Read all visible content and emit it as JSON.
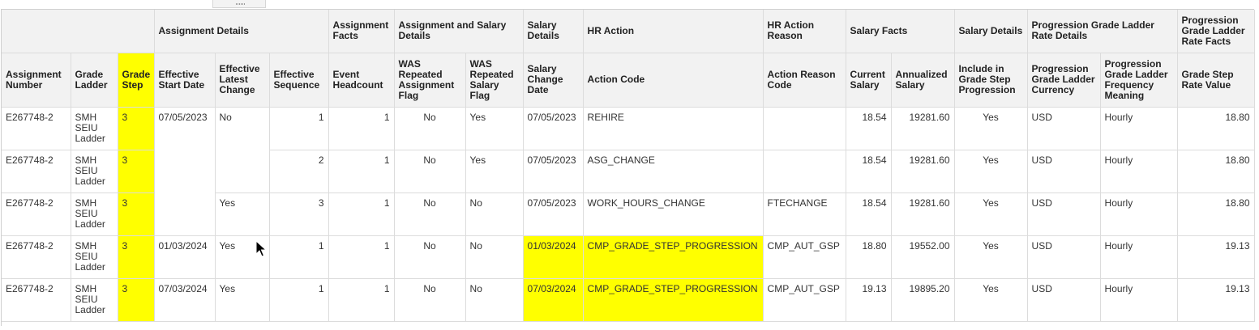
{
  "groups": [
    {
      "key": "blank",
      "label": ""
    },
    {
      "key": "assignment_details",
      "label": "Assignment Details"
    },
    {
      "key": "assignment_facts",
      "label": "Assignment Facts"
    },
    {
      "key": "assignment_salary_details",
      "label": "Assignment and Salary Details"
    },
    {
      "key": "salary_details",
      "label": "Salary Details"
    },
    {
      "key": "hr_action",
      "label": "HR Action"
    },
    {
      "key": "hr_action_reason",
      "label": "HR Action Reason"
    },
    {
      "key": "salary_facts",
      "label": "Salary Facts"
    },
    {
      "key": "salary_details2",
      "label": "Salary Details"
    },
    {
      "key": "progression_rate_details",
      "label": "Progression Grade Ladder Rate Details"
    },
    {
      "key": "progression_rate_facts",
      "label": "Progression Grade Ladder Rate Facts"
    }
  ],
  "columns": [
    {
      "key": "assignment_number",
      "label": "Assignment Number"
    },
    {
      "key": "grade_ladder",
      "label": "Grade Ladder"
    },
    {
      "key": "grade_step",
      "label": "Grade Step"
    },
    {
      "key": "effective_start_date",
      "label": "Effective Start Date"
    },
    {
      "key": "effective_latest_change",
      "label": "Effective Latest Change"
    },
    {
      "key": "effective_sequence",
      "label": "Effective Sequence"
    },
    {
      "key": "event_headcount",
      "label": "Event Headcount"
    },
    {
      "key": "was_repeated_assignment_flag",
      "label": "WAS Repeated Assignment Flag"
    },
    {
      "key": "was_repeated_salary_flag",
      "label": "WAS Repeated Salary Flag"
    },
    {
      "key": "salary_change_date",
      "label": "Salary Change Date"
    },
    {
      "key": "action_code",
      "label": "Action Code"
    },
    {
      "key": "action_reason_code",
      "label": "Action Reason Code"
    },
    {
      "key": "current_salary",
      "label": "Current Salary"
    },
    {
      "key": "annualized_salary",
      "label": "Annualized Salary"
    },
    {
      "key": "include_in_grade_step_progression",
      "label": "Include in Grade Step Progression"
    },
    {
      "key": "progression_grade_ladder_currency",
      "label": "Progression Grade Ladder Currency"
    },
    {
      "key": "progression_grade_ladder_frequency_meaning",
      "label": "Progression Grade Ladder Frequency Meaning"
    },
    {
      "key": "grade_step_rate_value",
      "label": "Grade Step Rate Value"
    }
  ],
  "rows": [
    {
      "assignment_number": "E267748-2",
      "grade_ladder": "SMH SEIU Ladder",
      "grade_step": "3",
      "effective_start_date": "07/05/2023",
      "effective_latest_change": "No",
      "effective_sequence": "1",
      "event_headcount": "1",
      "was_repeated_assignment_flag": "No",
      "was_repeated_salary_flag": "Yes",
      "salary_change_date": "07/05/2023",
      "action_code": "REHIRE",
      "action_reason_code": "",
      "current_salary": "18.54",
      "annualized_salary": "19281.60",
      "include_in_grade_step_progression": "Yes",
      "progression_grade_ladder_currency": "USD",
      "progression_grade_ladder_frequency_meaning": "Hourly",
      "grade_step_rate_value": "18.80"
    },
    {
      "assignment_number": "E267748-2",
      "grade_ladder": "SMH SEIU Ladder",
      "grade_step": "3",
      "effective_start_date": "",
      "effective_latest_change": "",
      "effective_sequence": "2",
      "event_headcount": "1",
      "was_repeated_assignment_flag": "No",
      "was_repeated_salary_flag": "Yes",
      "salary_change_date": "07/05/2023",
      "action_code": "ASG_CHANGE",
      "action_reason_code": "",
      "current_salary": "18.54",
      "annualized_salary": "19281.60",
      "include_in_grade_step_progression": "Yes",
      "progression_grade_ladder_currency": "USD",
      "progression_grade_ladder_frequency_meaning": "Hourly",
      "grade_step_rate_value": "18.80"
    },
    {
      "assignment_number": "E267748-2",
      "grade_ladder": "SMH SEIU Ladder",
      "grade_step": "3",
      "effective_start_date": "",
      "effective_latest_change": "Yes",
      "effective_sequence": "3",
      "event_headcount": "1",
      "was_repeated_assignment_flag": "No",
      "was_repeated_salary_flag": "No",
      "salary_change_date": "07/05/2023",
      "action_code": "WORK_HOURS_CHANGE",
      "action_reason_code": "FTECHANGE",
      "current_salary": "18.54",
      "annualized_salary": "19281.60",
      "include_in_grade_step_progression": "Yes",
      "progression_grade_ladder_currency": "USD",
      "progression_grade_ladder_frequency_meaning": "Hourly",
      "grade_step_rate_value": "18.80"
    },
    {
      "assignment_number": "E267748-2",
      "grade_ladder": "SMH SEIU Ladder",
      "grade_step": "3",
      "effective_start_date": "01/03/2024",
      "effective_latest_change": "Yes",
      "effective_sequence": "1",
      "event_headcount": "1",
      "was_repeated_assignment_flag": "No",
      "was_repeated_salary_flag": "No",
      "salary_change_date": "01/03/2024",
      "action_code": "CMP_GRADE_STEP_PROGRESSION",
      "action_reason_code": "CMP_AUT_GSP",
      "current_salary": "18.80",
      "annualized_salary": "19552.00",
      "include_in_grade_step_progression": "Yes",
      "progression_grade_ladder_currency": "USD",
      "progression_grade_ladder_frequency_meaning": "Hourly",
      "grade_step_rate_value": "19.13"
    },
    {
      "assignment_number": "E267748-2",
      "grade_ladder": "SMH SEIU Ladder",
      "grade_step": "3",
      "effective_start_date": "07/03/2024",
      "effective_latest_change": "Yes",
      "effective_sequence": "1",
      "event_headcount": "1",
      "was_repeated_assignment_flag": "No",
      "was_repeated_salary_flag": "No",
      "salary_change_date": "07/03/2024",
      "action_code": "CMP_GRADE_STEP_PROGRESSION",
      "action_reason_code": "CMP_AUT_GSP",
      "current_salary": "19.13",
      "annualized_salary": "19895.20",
      "include_in_grade_step_progression": "Yes",
      "progression_grade_ladder_currency": "USD",
      "progression_grade_ladder_frequency_meaning": "Hourly",
      "grade_step_rate_value": "19.13"
    }
  ],
  "highlight_color": "#ffff00"
}
